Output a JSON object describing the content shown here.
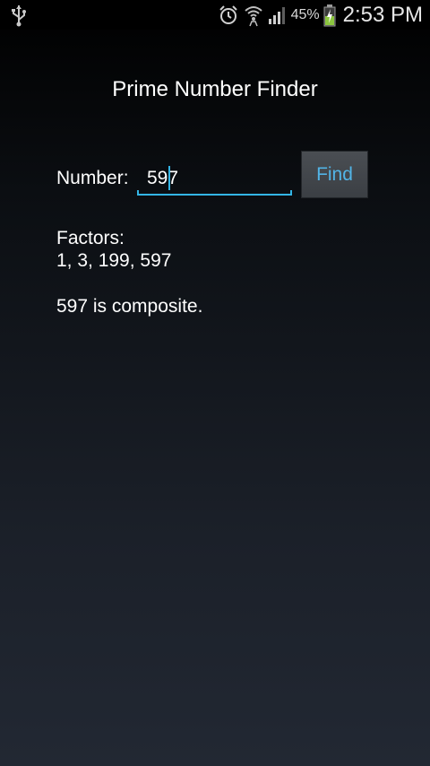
{
  "status_bar": {
    "icons": [
      "usb-icon",
      "alarm-icon",
      "wifi-icon",
      "signal-icon",
      "battery-charging-icon"
    ],
    "battery_percent": "45%",
    "time": "2:53 PM"
  },
  "app": {
    "title": "Prime Number Finder"
  },
  "form": {
    "number_label": "Number:",
    "number_value": "597",
    "find_label": "Find"
  },
  "result": {
    "factors_label": "Factors:",
    "factors_value": "1, 3, 199, 597",
    "message": "597 is composite."
  },
  "colors": {
    "accent": "#33b5e5",
    "button_text": "#52b4e6",
    "text": "#ffffff"
  }
}
